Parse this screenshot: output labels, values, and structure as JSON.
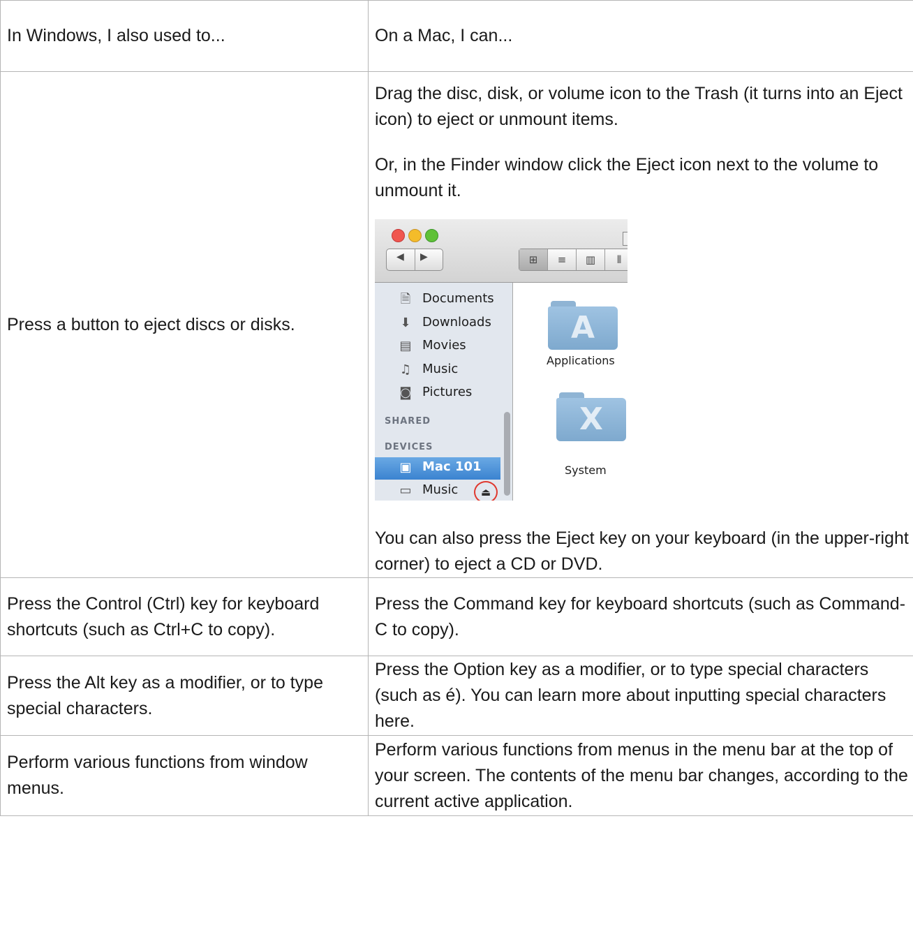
{
  "header": {
    "windows": "In Windows, I also used to...",
    "mac": "On a Mac, I can..."
  },
  "rows": {
    "eject": {
      "windows": "Press a button to eject discs or disks.",
      "mac_p1": "Drag the disc, disk, or volume icon to the Trash (it turns into an Eject icon) to eject or unmount items.",
      "mac_p2": "Or, in the Finder window click the Eject icon next to the volume to unmount it.",
      "mac_p3": "You can also press the Eject key on your keyboard (in the upper-right corner) to eject a CD or DVD."
    },
    "ctrl": {
      "windows": "Press the Control (Ctrl) key for keyboard shortcuts (such as Ctrl+C to copy).",
      "mac": "Press the Command key for keyboard shortcuts (such as Command-C to copy)."
    },
    "alt": {
      "windows": "Press the Alt key as a modifier, or to type special characters.",
      "mac": "Press the Option key as a modifier, or to type special characters (such as é). You can learn more about inputting special characters here."
    },
    "menus": {
      "windows": "Perform various functions from window menus.",
      "mac": "Perform various functions from menus in the menu bar at the top of your screen. The contents of the menu bar changes, according to the current active application."
    }
  },
  "finder": {
    "sidebar": {
      "places": [
        "Documents",
        "Downloads",
        "Movies",
        "Music",
        "Pictures"
      ],
      "shared_heading": "SHARED",
      "devices_heading": "DEVICES",
      "devices": [
        "Mac 101",
        "Music"
      ]
    },
    "folders": [
      "Applications",
      "System"
    ],
    "icons": {
      "view_icon": "icon-view-icon",
      "view_list": "list-view-icon",
      "view_columns": "column-view-icon",
      "view_coverflow": "coverflow-view-icon",
      "eject": "eject-icon"
    },
    "colors": {
      "selection": "#3b83d0",
      "eject_highlight": "#e0392f",
      "folder": "#8fb4d4"
    }
  }
}
